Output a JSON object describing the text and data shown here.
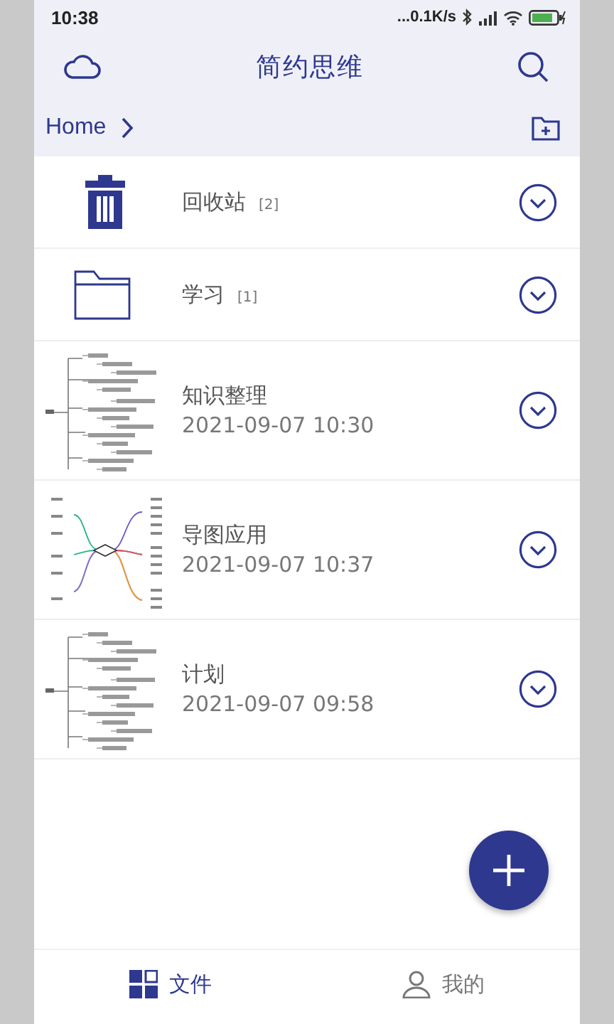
{
  "status_bar": {
    "time": "10:38",
    "network_speed": "...0.1K/s"
  },
  "app_bar": {
    "title": "简约思维"
  },
  "breadcrumb": {
    "label": "Home"
  },
  "items": [
    {
      "kind": "trash",
      "name": "回收站",
      "count": "[2]"
    },
    {
      "kind": "folder",
      "name": "学习",
      "count": "[1]"
    },
    {
      "kind": "outline",
      "name": "知识整理",
      "date": "2021-09-07 10:30"
    },
    {
      "kind": "mindmap",
      "name": "导图应用",
      "date": "2021-09-07 10:37"
    },
    {
      "kind": "outline",
      "name": "计划",
      "date": "2021-09-07 09:58"
    }
  ],
  "bottom_nav": [
    {
      "label": "文件",
      "selected": true
    },
    {
      "label": "我的",
      "selected": false
    }
  ]
}
